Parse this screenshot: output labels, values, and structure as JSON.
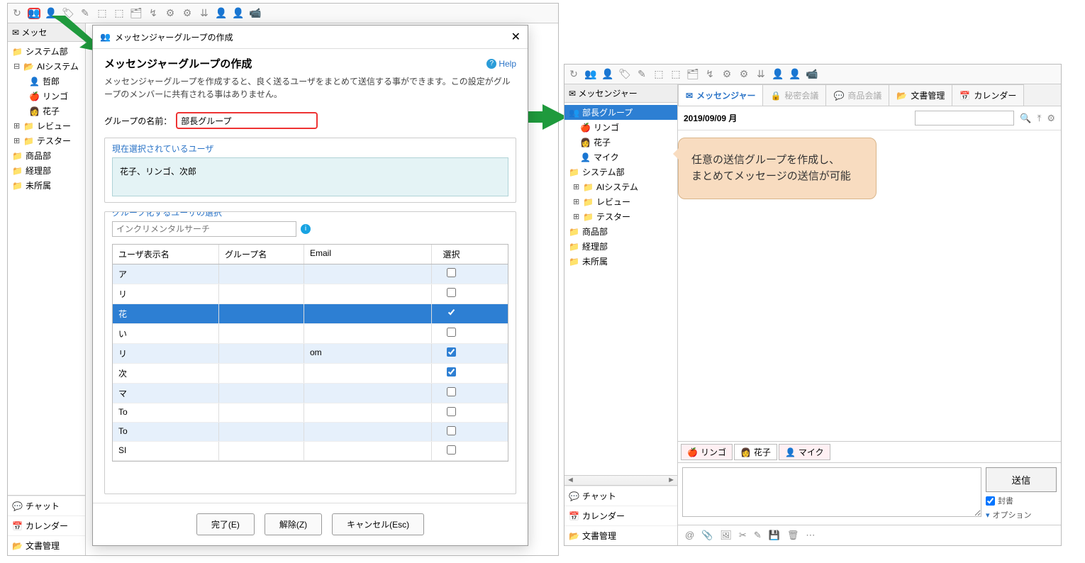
{
  "leftWindow": {
    "toolbar_icons": [
      "↻",
      "👥",
      "👤",
      "🏷",
      "✎",
      "⬚",
      "⬚",
      "🗂",
      "↯",
      "⚙",
      "⚙",
      "⇊",
      "👤",
      "👤",
      "📹"
    ],
    "tree_header": "メッセ",
    "tree": {
      "system": "システム部",
      "ai": "AIシステム",
      "users": [
        "哲郎",
        "リンゴ",
        "花子"
      ],
      "review": "レビュー",
      "tester": "テスター",
      "product": "商品部",
      "accounting": "経理部",
      "unassigned": "未所属"
    },
    "footer": {
      "chat": "チャット",
      "calendar": "カレンダー",
      "docs": "文書管理"
    }
  },
  "dialog": {
    "window_title": "メッセンジャーグループの作成",
    "heading": "メッセンジャーグループの作成",
    "help": "Help",
    "desc": "メッセンジャーグループを作成すると、良く送るユーザをまとめて送信する事ができます。この設定がグループのメンバーに共有される事はありません。",
    "name_label": "グループの名前：",
    "name_value": "部長グループ",
    "selected_legend": "現在選択されているユーザ",
    "selected_text": "花子、リンゴ、次郎",
    "pick_legend": "グループ化するユーザの選択",
    "search_placeholder": "インクリメンタルサーチ",
    "cols": {
      "name": "ユーザ表示名",
      "group": "グループ名",
      "email": "Email",
      "select": "選択"
    },
    "rows": [
      {
        "name": "ア",
        "group": "",
        "email": "",
        "checked": false,
        "cls": "bluebg"
      },
      {
        "name": "リ",
        "group": "",
        "email": "",
        "checked": false
      },
      {
        "name": "花",
        "group": "",
        "email": "",
        "checked": true,
        "cls": "selected"
      },
      {
        "name": "い",
        "group": "",
        "email": "",
        "checked": false
      },
      {
        "name": "リ",
        "group": "",
        "email": "om",
        "checked": true,
        "cls": "bluebg"
      },
      {
        "name": "次",
        "group": "",
        "email": "",
        "checked": true
      },
      {
        "name": "マ",
        "group": "",
        "email": "",
        "checked": false,
        "cls": "bluebg"
      },
      {
        "name": "To",
        "group": "",
        "email": "",
        "checked": false
      },
      {
        "name": "To",
        "group": "",
        "email": "",
        "checked": false,
        "cls": "bluebg"
      },
      {
        "name": "SI",
        "group": "",
        "email": "",
        "checked": false
      }
    ],
    "btn_done": "完了(E)",
    "btn_release": "解除(Z)",
    "btn_cancel": "キャンセル(Esc)"
  },
  "rightWindow": {
    "toolbar_icons": [
      "↻",
      "👥",
      "👤",
      "🏷",
      "✎",
      "⬚",
      "⬚",
      "🗂",
      "↯",
      "⚙",
      "⚙",
      "⇊",
      "👤",
      "👤",
      "📹"
    ],
    "tree_header": "メッセンジャー",
    "tree": {
      "group": "部長グループ",
      "users": [
        "リンゴ",
        "花子",
        "マイク"
      ],
      "system": "システム部",
      "ai": "AIシステム",
      "review": "レビュー",
      "tester": "テスター",
      "product": "商品部",
      "accounting": "経理部",
      "unassigned": "未所属"
    },
    "footer": {
      "chat": "チャット",
      "calendar": "カレンダー",
      "docs": "文書管理"
    },
    "tabs": {
      "messenger": "メッセンジャー",
      "secret": "秘密会議",
      "product": "商品会議",
      "docs": "文書管理",
      "calendar": "カレンダー"
    },
    "date": "2019/09/09 月",
    "callout": "任意の送信グループを作成し、\nまとめてメッセージの送信が可能",
    "recipients": [
      "リンゴ",
      "花子",
      "マイク"
    ],
    "send": "送信",
    "sealed": "封書",
    "options": "オプション"
  }
}
